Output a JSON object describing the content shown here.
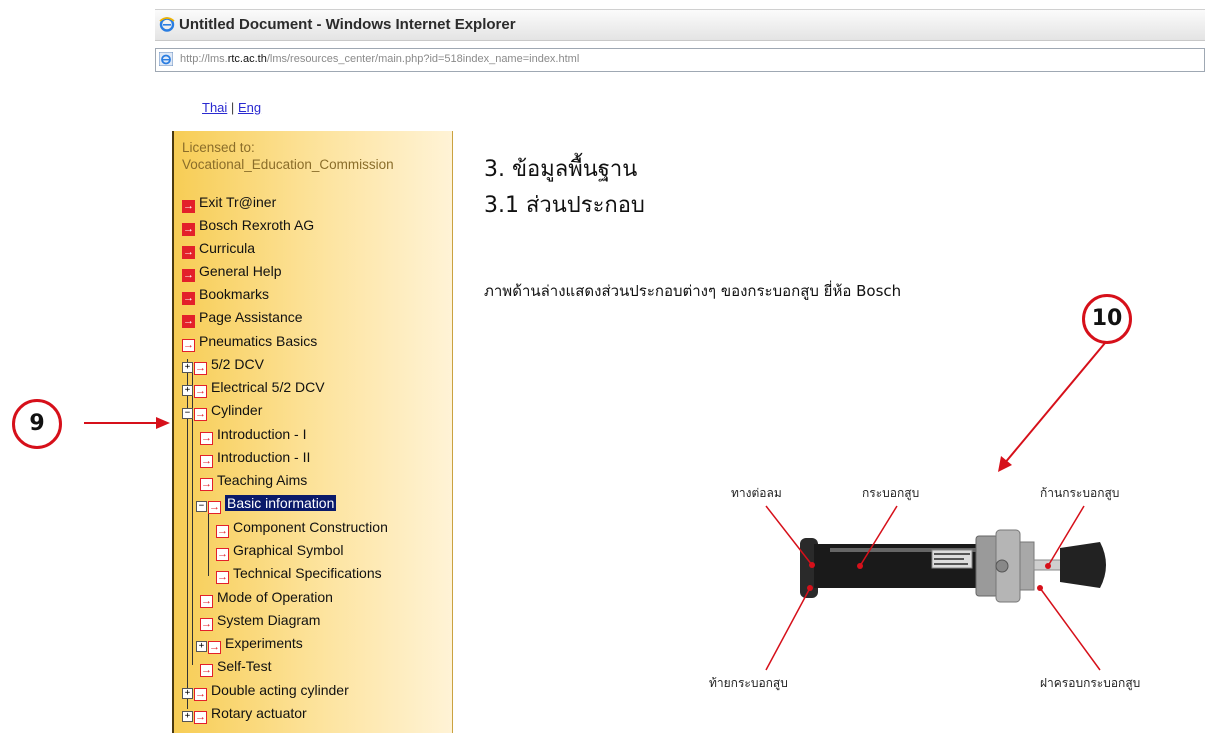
{
  "window": {
    "title": "Untitled Document - Windows Internet Explorer"
  },
  "address": {
    "url_prefix": "http://lms.",
    "url_domain": "rtc.ac.th",
    "url_rest": "/lms/resources_center/main.php?id=518index_name=index.html"
  },
  "lang": {
    "thai": "Thai",
    "sep": "|",
    "eng": "Eng"
  },
  "sidebar": {
    "licensed_label": "Licensed to:",
    "licensee": "Vocational_Education_Commission",
    "top_items": [
      "Exit Tr@iner",
      "Bosch Rexroth AG",
      "Curricula",
      "General Help",
      "Bookmarks",
      "Page Assistance"
    ],
    "tree": {
      "root": "Pneumatics Basics",
      "dcv": "5/2 DCV",
      "edcv": "Electrical 5/2 DCV",
      "cyl": "Cylinder",
      "intro1": "Introduction - I",
      "intro2": "Introduction - II",
      "aims": "Teaching Aims",
      "basic": "Basic information",
      "comp": "Component Construction",
      "graph": "Graphical Symbol",
      "tech": "Technical Specifications",
      "mode": "Mode of Operation",
      "sys": "System Diagram",
      "exp": "Experiments",
      "self": "Self-Test",
      "double": "Double acting cylinder",
      "rotary": "Rotary actuator"
    }
  },
  "content": {
    "heading1": "3. ข้อมูลพื้นฐาน",
    "heading2": "3.1 ส่วนประกอบ",
    "description": "ภาพด้านล่างแสดงส่วนประกอบต่างๆ ของกระบอกสูบ ยี่ห้อ Bosch",
    "labels": {
      "port": "ทางต่อลม",
      "barrel": "กระบอกสูบ",
      "rod": "ก้านกระบอกสูบ",
      "rear": "ท้ายกระบอกสูบ",
      "cover": "ฝาครอบกระบอกสูบ"
    }
  },
  "callouts": {
    "nine": "9",
    "ten": "10"
  },
  "colors": {
    "callout": "#d6101a",
    "selected": "#0a1a6a",
    "arrow_icon": "#e3202a"
  }
}
